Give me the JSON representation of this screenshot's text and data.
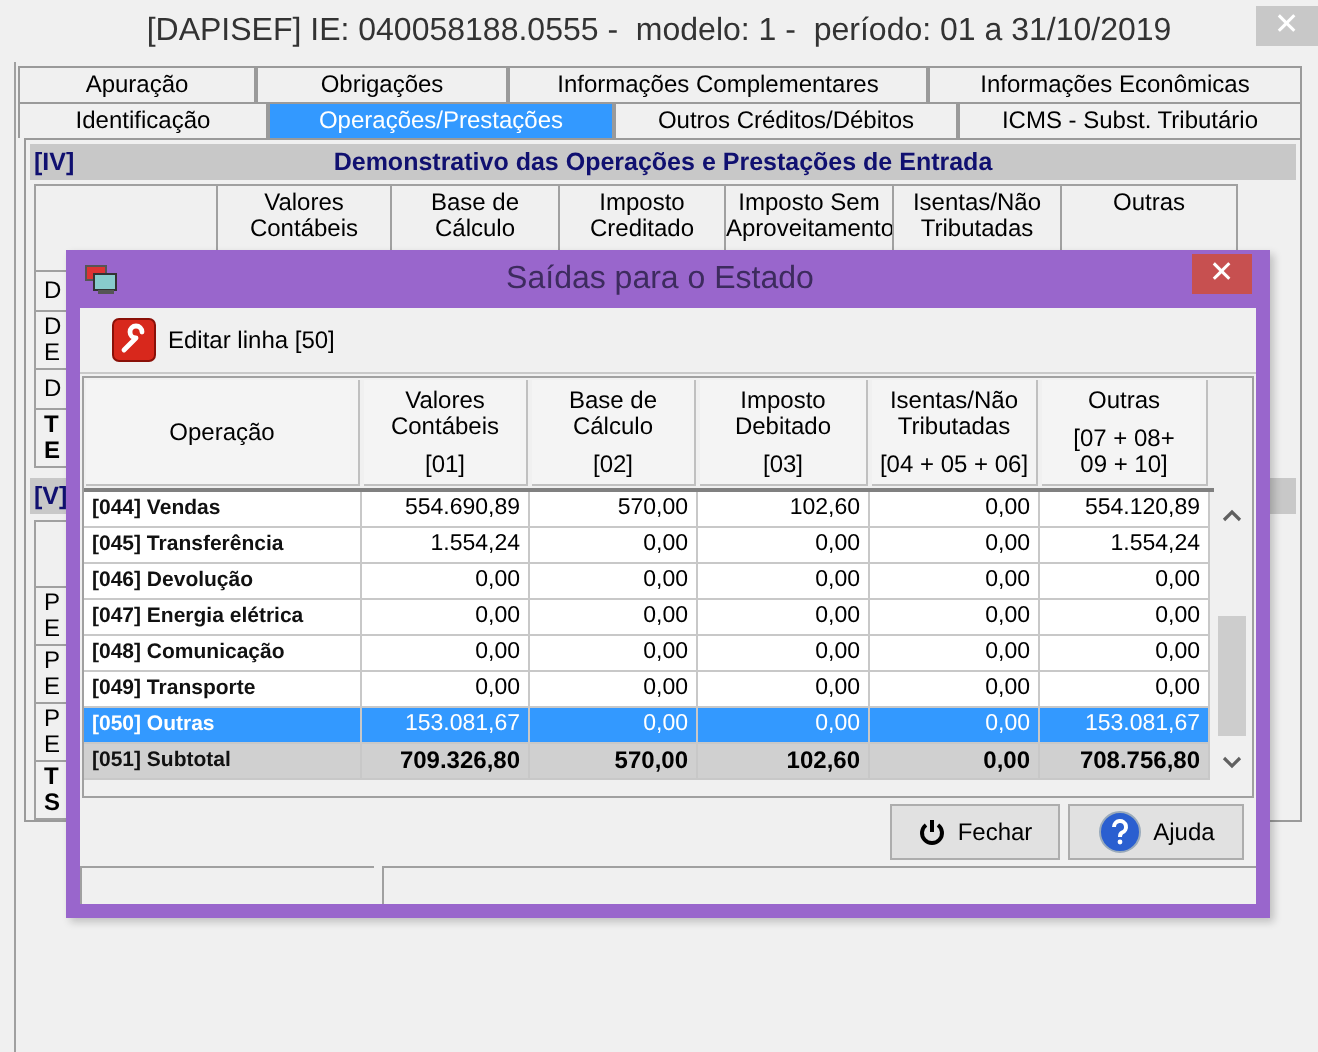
{
  "window": {
    "title": "[DAPISEF] IE: 040058188.0555 -  modelo: 1 -  período: 01 a 31/10/2019",
    "close_glyph": "✕"
  },
  "tab_rows": [
    {
      "tabs": [
        {
          "label": "Apuração",
          "selected": false
        },
        {
          "label": "Obrigações",
          "selected": false
        },
        {
          "label": "Informações Complementares",
          "selected": false
        },
        {
          "label": "Informações Econômicas",
          "selected": false
        }
      ]
    },
    {
      "tabs": [
        {
          "label": "Identificação",
          "selected": false
        },
        {
          "label": "Operações/Prestações",
          "selected": true
        },
        {
          "label": "Outros Créditos/Débitos",
          "selected": false
        },
        {
          "label": "ICMS - Subst. Tributário",
          "selected": false
        }
      ]
    }
  ],
  "section_iv": {
    "code": "[IV]",
    "title": "Demonstrativo das Operações e Prestações de Entrada",
    "columns": [
      "Valores\nContábeis",
      "Base de\nCálculo",
      "Imposto\nCreditado",
      "Imposto Sem\nAproveitamento",
      "Isentas/Não\nTributadas",
      "Outras"
    ],
    "row_labels": [
      {
        "lines": [
          "D"
        ],
        "kind": "item"
      },
      {
        "lines": [
          "D",
          "E"
        ],
        "kind": "item"
      },
      {
        "lines": [
          "D"
        ],
        "kind": "item"
      },
      {
        "lines": [
          "T",
          "E"
        ],
        "kind": "total"
      }
    ]
  },
  "section_v": {
    "code": "[V]",
    "row_labels": [
      {
        "lines": [
          "P",
          "E"
        ],
        "kind": "item"
      },
      {
        "lines": [
          "P",
          "E"
        ],
        "kind": "item"
      },
      {
        "lines": [
          "P",
          "E"
        ],
        "kind": "item"
      },
      {
        "lines": [
          "T",
          "S"
        ],
        "kind": "total"
      }
    ]
  },
  "dialog": {
    "title": "Saídas para o Estado",
    "close_glyph": "✕",
    "toolbar_button": "Editar linha [50]",
    "columns": [
      {
        "label": "Operação"
      },
      {
        "label": "Valores\nContábeis",
        "ref": "[01]"
      },
      {
        "label": "Base de\nCálculo",
        "ref": "[02]"
      },
      {
        "label": "Imposto\nDebitado",
        "ref": "[03]"
      },
      {
        "label": "Isentas/Não\nTributadas",
        "ref": "[04 + 05 + 06]"
      },
      {
        "label": "Outras",
        "ref": "[07 + 08+\n09 + 10]"
      }
    ],
    "rows": [
      {
        "kind": "item",
        "selected": false,
        "cells": [
          "[044] Vendas",
          "554.690,89",
          "570,00",
          "102,60",
          "0,00",
          "554.120,89"
        ]
      },
      {
        "kind": "item",
        "selected": false,
        "cells": [
          "[045] Transferência",
          "1.554,24",
          "0,00",
          "0,00",
          "0,00",
          "1.554,24"
        ]
      },
      {
        "kind": "item",
        "selected": false,
        "cells": [
          "[046] Devolução",
          "0,00",
          "0,00",
          "0,00",
          "0,00",
          "0,00"
        ]
      },
      {
        "kind": "item",
        "selected": false,
        "cells": [
          "[047] Energia elétrica",
          "0,00",
          "0,00",
          "0,00",
          "0,00",
          "0,00"
        ]
      },
      {
        "kind": "item",
        "selected": false,
        "cells": [
          "[048] Comunicação",
          "0,00",
          "0,00",
          "0,00",
          "0,00",
          "0,00"
        ]
      },
      {
        "kind": "item",
        "selected": false,
        "cells": [
          "[049] Transporte",
          "0,00",
          "0,00",
          "0,00",
          "0,00",
          "0,00"
        ]
      },
      {
        "kind": "item",
        "selected": true,
        "cells": [
          "[050] Outras",
          "153.081,67",
          "0,00",
          "0,00",
          "0,00",
          "153.081,67"
        ]
      },
      {
        "kind": "subtotal",
        "selected": false,
        "cells": [
          "[051] Subtotal",
          "709.326,80",
          "570,00",
          "102,60",
          "0,00",
          "708.756,80"
        ]
      }
    ],
    "buttons": [
      {
        "label": "Fechar",
        "kind": "close"
      },
      {
        "label": "Ajuda",
        "kind": "help"
      }
    ]
  }
}
